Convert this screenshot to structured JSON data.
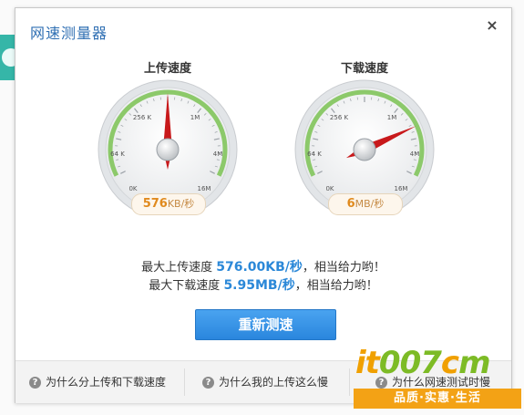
{
  "dialog": {
    "title": "网速测量器",
    "close_glyph": "×"
  },
  "upload": {
    "title": "上传速度",
    "readout_value": "576",
    "readout_unit": "KB/秒",
    "needle_fraction": 0.5
  },
  "download": {
    "title": "下载速度",
    "readout_value": "6",
    "readout_unit": "MB/秒",
    "needle_fraction": 0.78
  },
  "gauge_labels": {
    "0k": "0K",
    "64k": "64 K",
    "256k": "256 K",
    "1m": "1M",
    "4m": "4M",
    "16m": "16M"
  },
  "stats": {
    "upload_prefix": "最大上传速度",
    "upload_value": "576.00KB/秒",
    "upload_suffix": "，相当给力哟！",
    "download_prefix": "最大下载速度",
    "download_value": "5.95MB/秒",
    "download_suffix": "，相当给力哟！"
  },
  "retest_label": "重新测速",
  "footer": {
    "faq1": "为什么分上传和下载速度",
    "faq2": "为什么我的上传这么慢",
    "faq3": "为什么网速测试时慢"
  },
  "watermark": {
    "logo_a": "it",
    "logo_b": "007",
    "logo_c": "c",
    "logo_d": "m",
    "slogan": "品质·实惠·生活"
  },
  "colors": {
    "title_blue": "#2f6fb3",
    "needle_red": "#c8191b",
    "stat_blue": "#2b88d8",
    "button_blue": "#2a86dd",
    "gauge_green": "#8cc96a"
  }
}
